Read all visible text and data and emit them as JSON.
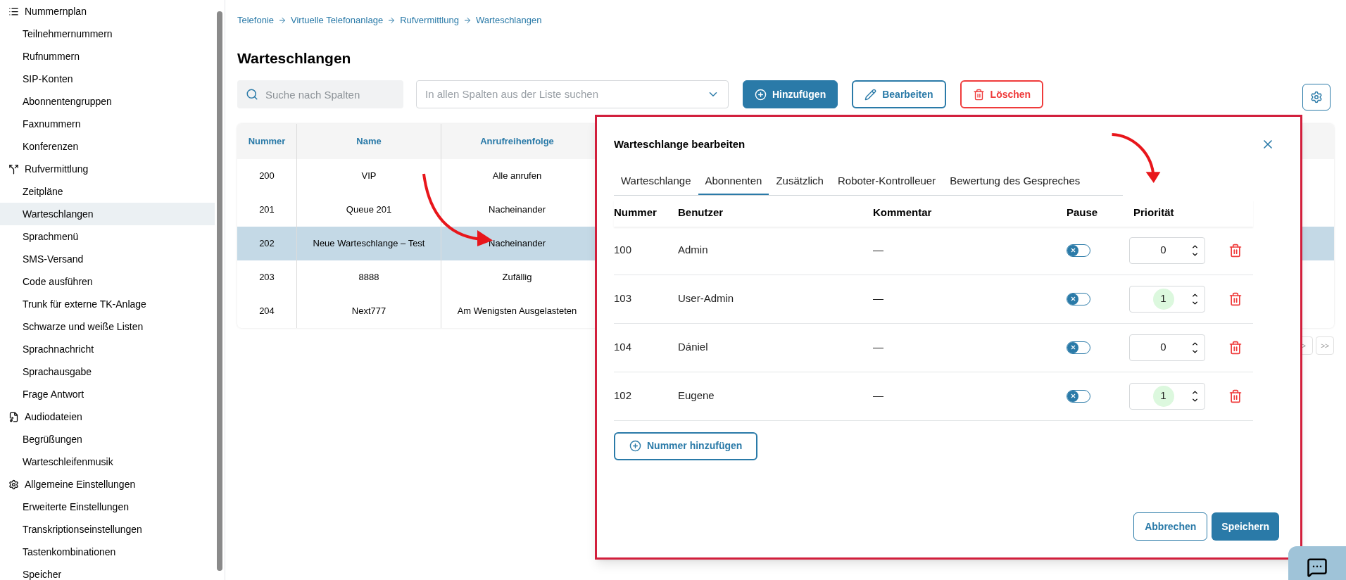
{
  "sidebar": {
    "items": [
      {
        "label": "Nummernplan",
        "children": [
          {
            "label": "Teilnehmernummern",
            "selected": false
          },
          {
            "label": "Rufnummern",
            "selected": false
          },
          {
            "label": "SIP-Konten",
            "selected": false
          },
          {
            "label": "Abonnentengruppen",
            "selected": false
          },
          {
            "label": "Faxnummern",
            "selected": false
          },
          {
            "label": "Konferenzen",
            "selected": false
          }
        ]
      },
      {
        "label": "Rufvermittlung",
        "children": [
          {
            "label": "Zeitpläne",
            "selected": false
          },
          {
            "label": "Warteschlangen",
            "selected": true
          },
          {
            "label": "Sprachmenü",
            "selected": false
          },
          {
            "label": "SMS-Versand",
            "selected": false
          },
          {
            "label": "Code ausführen",
            "selected": false
          },
          {
            "label": "Trunk für externe TK-Anlage",
            "selected": false
          },
          {
            "label": "Schwarze und weiße Listen",
            "selected": false
          },
          {
            "label": "Sprachnachricht",
            "selected": false
          },
          {
            "label": "Sprachausgabe",
            "selected": false
          },
          {
            "label": "Frage Antwort",
            "selected": false
          }
        ]
      },
      {
        "label": "Audiodateien",
        "children": [
          {
            "label": "Begrüßungen",
            "selected": false
          },
          {
            "label": "Warteschleifenmusik",
            "selected": false
          }
        ]
      },
      {
        "label": "Allgemeine Einstellungen",
        "children": [
          {
            "label": "Erweiterte Einstellungen",
            "selected": false
          },
          {
            "label": "Transkriptionseinstellungen",
            "selected": false
          },
          {
            "label": "Tastenkombinationen",
            "selected": false
          },
          {
            "label": "Speicher",
            "selected": false
          }
        ]
      }
    ]
  },
  "breadcrumb": [
    "Telefonie",
    "Virtuelle Telefonanlage",
    "Rufvermittlung",
    "Warteschlangen"
  ],
  "page_title": "Warteschlangen",
  "search": {
    "placeholder": "Suche nach Spalten"
  },
  "column_filter": {
    "placeholder": "In allen Spalten aus der Liste suchen"
  },
  "toolbar": {
    "buttons": [
      {
        "label": "Hinzufügen",
        "kind": "primary"
      },
      {
        "label": "Bearbeiten",
        "kind": "outline"
      },
      {
        "label": "Löschen",
        "kind": "danger"
      }
    ]
  },
  "table": {
    "columns": [
      "Nummer",
      "Name",
      "Anrufreihenfolge"
    ],
    "rows": [
      {
        "cells": [
          "200",
          "VIP",
          "Alle anrufen"
        ],
        "selected": false
      },
      {
        "cells": [
          "201",
          "Queue 201",
          "Nacheinander"
        ],
        "selected": false
      },
      {
        "cells": [
          "202",
          "Neue Warteschlange – Test",
          "Nacheinander"
        ],
        "selected": true
      },
      {
        "cells": [
          "203",
          "8888",
          "Zufällig"
        ],
        "selected": false
      },
      {
        "cells": [
          "204",
          "Next777",
          "Am Wenigsten Ausgelasteten"
        ],
        "selected": false
      }
    ]
  },
  "pagination": [
    ">",
    ">>"
  ],
  "dialog": {
    "title": "Warteschlange bearbeiten",
    "tabs": [
      {
        "label": "Warteschlange",
        "selected": false
      },
      {
        "label": "Abonnenten",
        "selected": true
      },
      {
        "label": "Zusätzlich",
        "selected": false
      },
      {
        "label": "Roboter-Kontrolleuer",
        "selected": false
      },
      {
        "label": "Bewertung des Gespreches",
        "selected": false
      }
    ],
    "columns": [
      "Nummer",
      "Benutzer",
      "Kommentar",
      "Pause",
      "Priorität"
    ],
    "rows": [
      {
        "number": "100",
        "user": "Admin",
        "comment": "—",
        "pause": false,
        "priority": "0",
        "highlighted": false
      },
      {
        "number": "103",
        "user": "User-Admin",
        "comment": "—",
        "pause": false,
        "priority": "1",
        "highlighted": true
      },
      {
        "number": "104",
        "user": "Dániel",
        "comment": "—",
        "pause": false,
        "priority": "0",
        "highlighted": false
      },
      {
        "number": "102",
        "user": "Eugene",
        "comment": "—",
        "pause": false,
        "priority": "1",
        "highlighted": true
      }
    ],
    "add_button": "Nummer hinzufügen",
    "cancel_button": "Abbrechen",
    "save_button": "Speichern"
  }
}
